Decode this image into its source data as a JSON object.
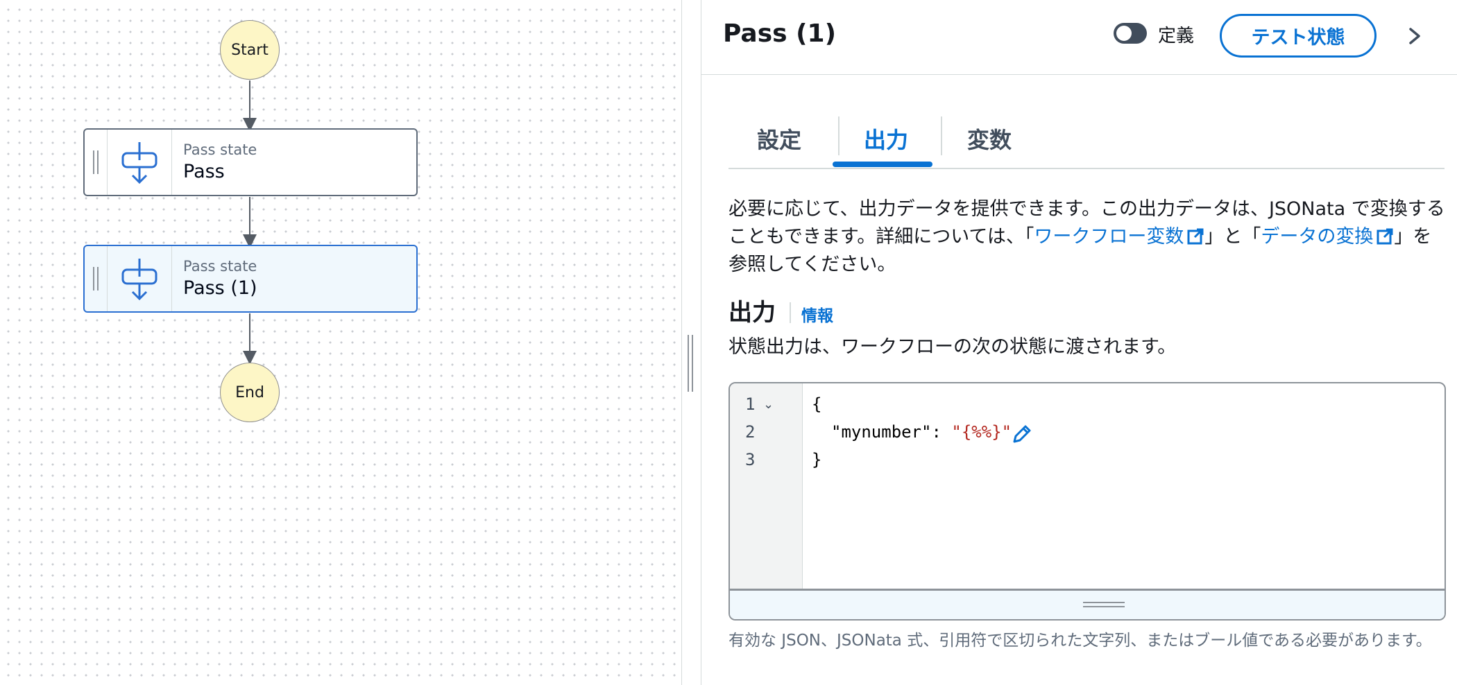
{
  "canvas": {
    "start_label": "Start",
    "end_label": "End",
    "states": [
      {
        "type_label": "Pass state",
        "name": "Pass",
        "selected": false
      },
      {
        "type_label": "Pass state",
        "name": "Pass (1)",
        "selected": true
      }
    ]
  },
  "panel": {
    "title": "Pass (1)",
    "toggle_label": "定義",
    "toggle_on": false,
    "test_button_label": "テスト状態",
    "tabs": [
      {
        "label": "設定",
        "active": false
      },
      {
        "label": "出力",
        "active": true
      },
      {
        "label": "変数",
        "active": false
      }
    ],
    "description": {
      "part1": "必要に応じて、出力データを提供できます。この出力データは、JSONata で変換することもできます。詳細については、「",
      "link1": "ワークフロー変数",
      "part2": "」と「",
      "link2": "データの変換",
      "part3": "」を参照してください。"
    },
    "output": {
      "heading": "出力",
      "info_link": "情報",
      "description": "状態出力は、ワークフローの次の状態に渡されます。",
      "editor": {
        "line_numbers": [
          "1",
          "2",
          "3"
        ],
        "lines": [
          "{",
          "\"mynumber\": ",
          "}"
        ],
        "string_value": "\"{%%}\""
      },
      "hint": "有効な JSON、JSONata 式、引用符で区切られた文字列、またはブール値である必要があります。"
    },
    "colors": {
      "accent": "#0972d3",
      "start_end_fill": "#fdf6c6",
      "selected_fill": "#f0f8fd"
    }
  }
}
